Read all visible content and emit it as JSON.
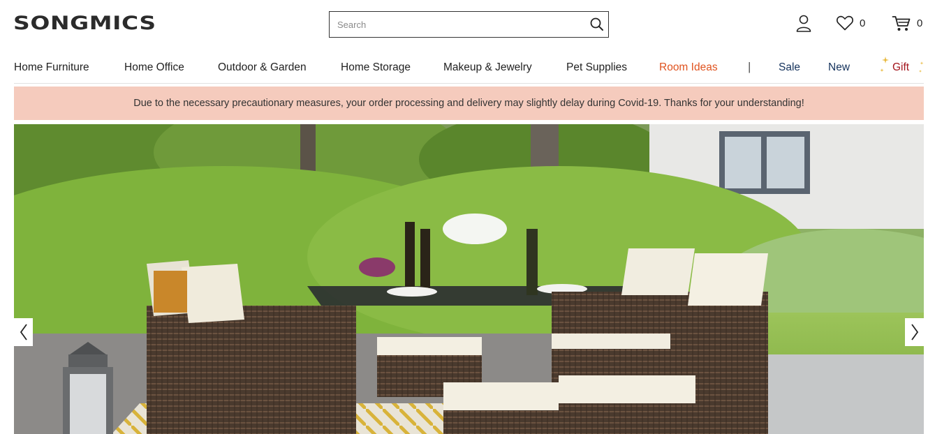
{
  "header": {
    "logo": "SONGMICS",
    "search": {
      "placeholder": "Search",
      "value": ""
    },
    "wishlist_count": "0",
    "cart_count": "0"
  },
  "nav": {
    "items": [
      "Home Furniture",
      "Home Office",
      "Outdoor & Garden",
      "Home Storage",
      "Makeup & Jewelry",
      "Pet Supplies",
      "Room Ideas"
    ],
    "separator": "|",
    "sale": "Sale",
    "new": "New",
    "gift": "Gift"
  },
  "notice": "Due to the necessary precautionary measures, your order processing and delivery may slightly delay during Covid-19. Thanks for your understanding!",
  "colors": {
    "room_ideas": "#e0531f",
    "sale_new": "#14325c",
    "gift": "#a3141c",
    "notice_bg": "#f5cbbd"
  },
  "icons": {
    "search": "search-icon",
    "account": "user-icon",
    "wishlist": "heart-icon",
    "cart": "cart-icon",
    "prev": "chevron-left-icon",
    "next": "chevron-right-icon"
  }
}
